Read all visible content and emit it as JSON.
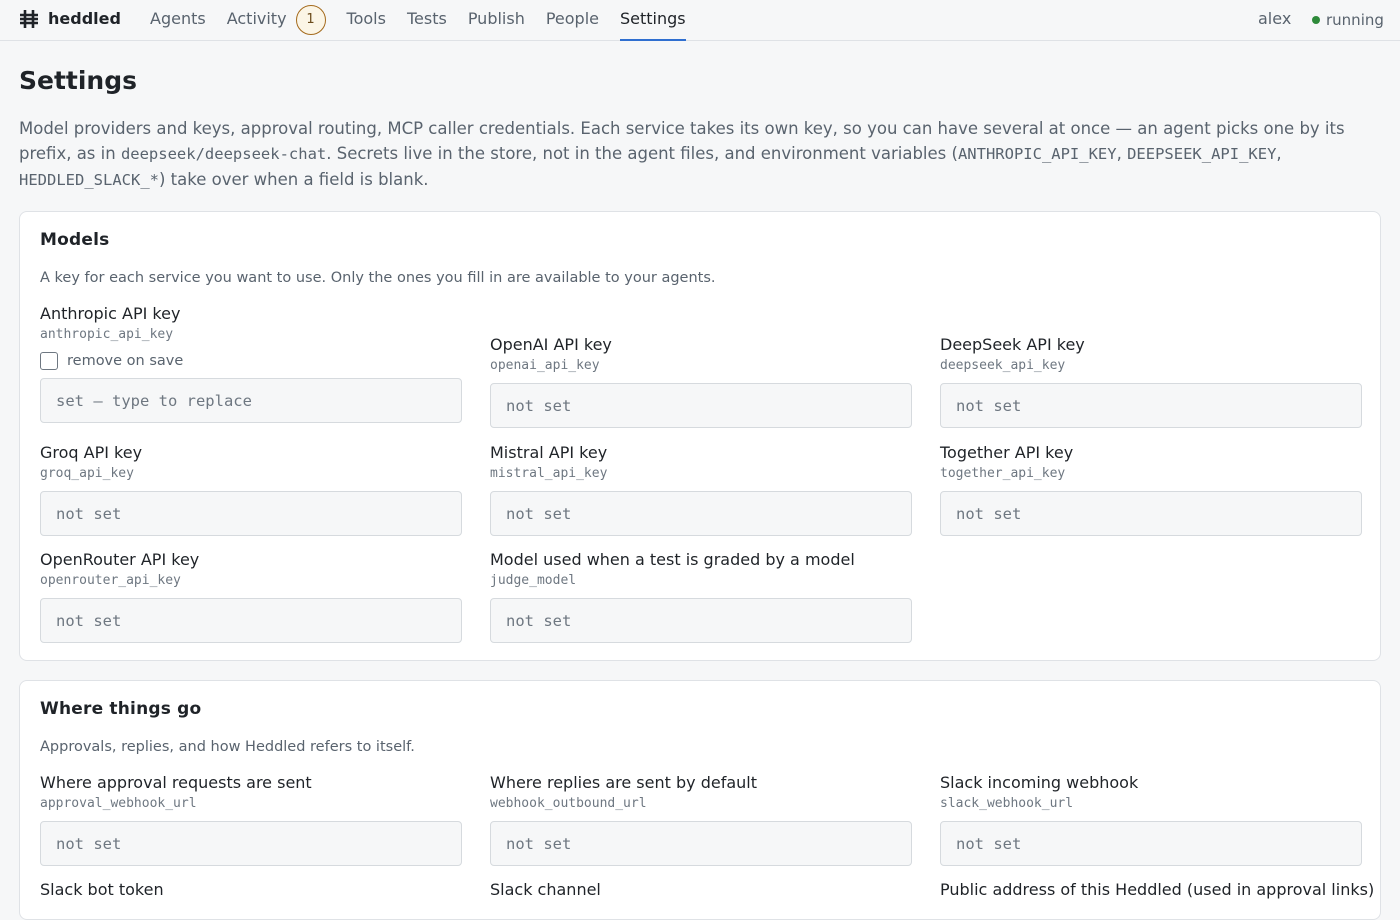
{
  "app": {
    "name": "heddled",
    "user": "alex",
    "status": "running"
  },
  "nav": [
    {
      "label": "Agents"
    },
    {
      "label": "Activity",
      "badge": "1"
    },
    {
      "label": "Tools"
    },
    {
      "label": "Tests"
    },
    {
      "label": "Publish"
    },
    {
      "label": "People"
    },
    {
      "label": "Settings",
      "active": true
    }
  ],
  "page": {
    "title": "Settings",
    "intro": {
      "p1": "Model providers and keys, approval routing, MCP caller credentials. Each service takes its own key, so you can have several at once — an agent picks one by its prefix, as in ",
      "code1": "deepseek/deepseek-chat",
      "p2": ". Secrets live in the store, not in the agent files, and environment variables (",
      "code2": "ANTHROPIC_API_KEY",
      "sep": ", ",
      "code3": "DEEPSEEK_API_KEY",
      "sep2": ", ",
      "code4": "HEDDLED_SLACK_*",
      "p3": ") take over when a field is blank."
    }
  },
  "models": {
    "title": "Models",
    "desc": "A key for each service you want to use. Only the ones you fill in are available to your agents.",
    "remove_label": "remove on save",
    "fields": [
      {
        "label": "Anthropic API key",
        "key": "anthropic_api_key",
        "placeholder": "set — type to replace"
      },
      {
        "label": "OpenAI API key",
        "key": "openai_api_key",
        "placeholder": "not set"
      },
      {
        "label": "DeepSeek API key",
        "key": "deepseek_api_key",
        "placeholder": "not set"
      },
      {
        "label": "Groq API key",
        "key": "groq_api_key",
        "placeholder": "not set"
      },
      {
        "label": "Mistral API key",
        "key": "mistral_api_key",
        "placeholder": "not set"
      },
      {
        "label": "Together API key",
        "key": "together_api_key",
        "placeholder": "not set"
      },
      {
        "label": "OpenRouter API key",
        "key": "openrouter_api_key",
        "placeholder": "not set"
      },
      {
        "label": "Model used when a test is graded by a model",
        "key": "judge_model",
        "placeholder": "not set"
      }
    ]
  },
  "routing": {
    "title": "Where things go",
    "desc": "Approvals, replies, and how Heddled refers to itself.",
    "fields": [
      {
        "label": "Where approval requests are sent",
        "key": "approval_webhook_url",
        "placeholder": "not set"
      },
      {
        "label": "Where replies are sent by default",
        "key": "webhook_outbound_url",
        "placeholder": "not set"
      },
      {
        "label": "Slack incoming webhook",
        "key": "slack_webhook_url",
        "placeholder": "not set"
      },
      {
        "label": "Slack bot token"
      },
      {
        "label": "Slack channel"
      },
      {
        "label": "Public address of this Heddled (used in approval links)"
      }
    ]
  }
}
